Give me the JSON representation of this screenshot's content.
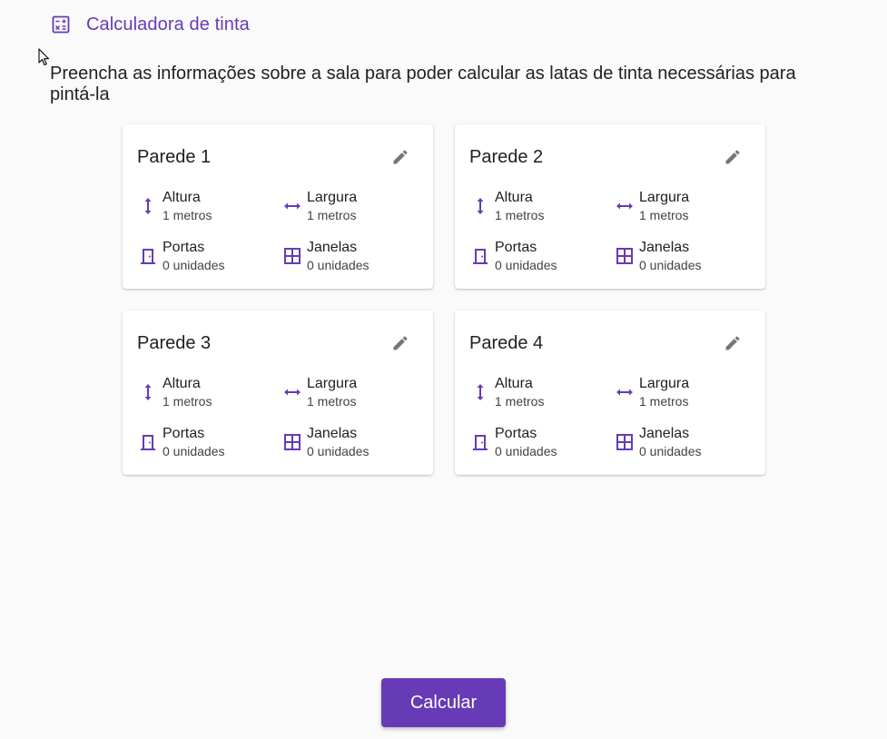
{
  "app": {
    "title": "Calculadora de tinta",
    "icon": "calculator-icon",
    "accent": "#673ab7"
  },
  "description": "Preencha as informações sobre a sala para poder calcular as latas de tinta necessárias para pintá-la",
  "walls": [
    {
      "title": "Parede 1",
      "height_label": "Altura",
      "height_value": "1 metros",
      "width_label": "Largura",
      "width_value": "1 metros",
      "doors_label": "Portas",
      "doors_value": "0 unidades",
      "windows_label": "Janelas",
      "windows_value": "0 unidades"
    },
    {
      "title": "Parede 2",
      "height_label": "Altura",
      "height_value": "1 metros",
      "width_label": "Largura",
      "width_value": "1 metros",
      "doors_label": "Portas",
      "doors_value": "0 unidades",
      "windows_label": "Janelas",
      "windows_value": "0 unidades"
    },
    {
      "title": "Parede 3",
      "height_label": "Altura",
      "height_value": "1 metros",
      "width_label": "Largura",
      "width_value": "1 metros",
      "doors_label": "Portas",
      "doors_value": "0 unidades",
      "windows_label": "Janelas",
      "windows_value": "0 unidades"
    },
    {
      "title": "Parede 4",
      "height_label": "Altura",
      "height_value": "1 metros",
      "width_label": "Largura",
      "width_value": "1 metros",
      "doors_label": "Portas",
      "doors_value": "0 unidades",
      "windows_label": "Janelas",
      "windows_value": "0 unidades"
    }
  ],
  "icons": {
    "edit": "pencil-icon",
    "height": "vertical-arrows-icon",
    "width": "horizontal-arrows-icon",
    "doors": "door-icon",
    "windows": "window-icon"
  },
  "actions": {
    "calculate_label": "Calcular"
  }
}
